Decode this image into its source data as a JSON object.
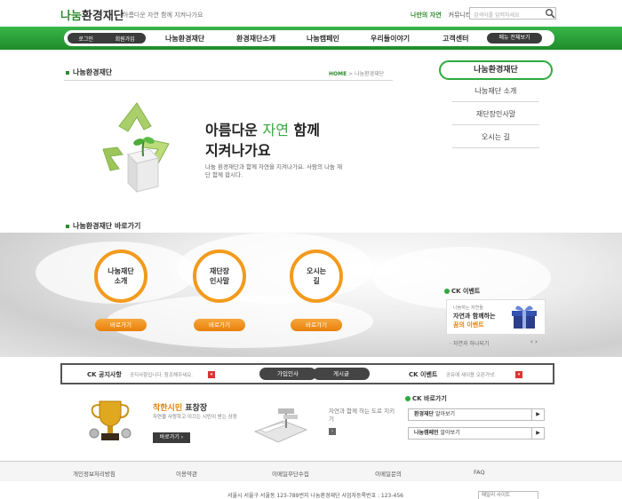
{
  "header": {
    "logo_green": "나눔",
    "logo_dark": "환경재단",
    "tagline": "아름다운 자연 함께 지켜나가요",
    "top_links": [
      "나만의 자연",
      "커뮤니티"
    ],
    "search_placeholder": "검색어를 입력하세요"
  },
  "nav": {
    "login": "로그인",
    "join": "회원가입",
    "items": [
      "나눔환경재단",
      "환경재단소개",
      "나눔캠페인",
      "우리들이야기",
      "고객센터"
    ],
    "all_menu": "메뉴 전체보기"
  },
  "main": {
    "title": "나눔환경재단",
    "breadcrumb_home": "HOME",
    "breadcrumb_current": "나눔환경재단"
  },
  "side_menu": {
    "title": "나눔환경재단",
    "items": [
      "나눔재단 소개",
      "재단장인사말",
      "오시는 길"
    ]
  },
  "hero": {
    "head_pre": "아름다운",
    "head_green": "자연",
    "head_post": "함께",
    "head_line2": "지켜나가요",
    "desc": "나눔 환경재단과 함께 자연을 지켜나가요. 사람의 나눔 재단 함께 합시다."
  },
  "shortcut": {
    "title": "나눔환경재단 바로가기",
    "circles": [
      {
        "line1": "나눔재단",
        "line2": "소개",
        "button": "바로가기"
      },
      {
        "line1": "재단장",
        "line2": "인사말",
        "button": "바로가기"
      },
      {
        "line1": "오시는",
        "line2": "길",
        "button": "바로가기"
      }
    ]
  },
  "ck_event": {
    "title": "CK 이벤트",
    "small": "나눔하는 자연들",
    "line1": "자연과 함께하는",
    "line2": "꿈의 이벤트",
    "caption": "자연과 하나되기"
  },
  "notice": {
    "label": "CK 공지사항",
    "text": "공지사항입니다. 참조해주세요.",
    "pill1": "가입인사",
    "pill2": "게시글",
    "event_label": "CK 이벤트",
    "event_text": "공유에 새이용 오픈가넷."
  },
  "award": {
    "title_orange": "착한시민",
    "title_dark": "표창장",
    "desc": "자연을 사랑하고 이끄는 시민이 받는 상장",
    "button": "바로가기"
  },
  "road": {
    "text": "자연과 함께 하는 도로 지키기"
  },
  "ck_go": {
    "title": "CK 바로가기",
    "rows": [
      {
        "bold": "환경재단",
        "rest": " 알아보기"
      },
      {
        "bold": "나눔캠페인",
        "rest": " 알아보기"
      }
    ]
  },
  "footer": {
    "links": [
      "개인정보처리방침",
      "이용약관",
      "이메일무단수집",
      "이메일문의",
      "FAQ"
    ],
    "address": "서울시 서울구 서울동 123-789번지  나눔환경재단 사업자등록번호 : 123-456",
    "family_site": "패밀리 사이트"
  },
  "colors": {
    "brand_green": "#2e8b2e",
    "nav_green": "#39b649",
    "accent_orange": "#f39a1d"
  }
}
